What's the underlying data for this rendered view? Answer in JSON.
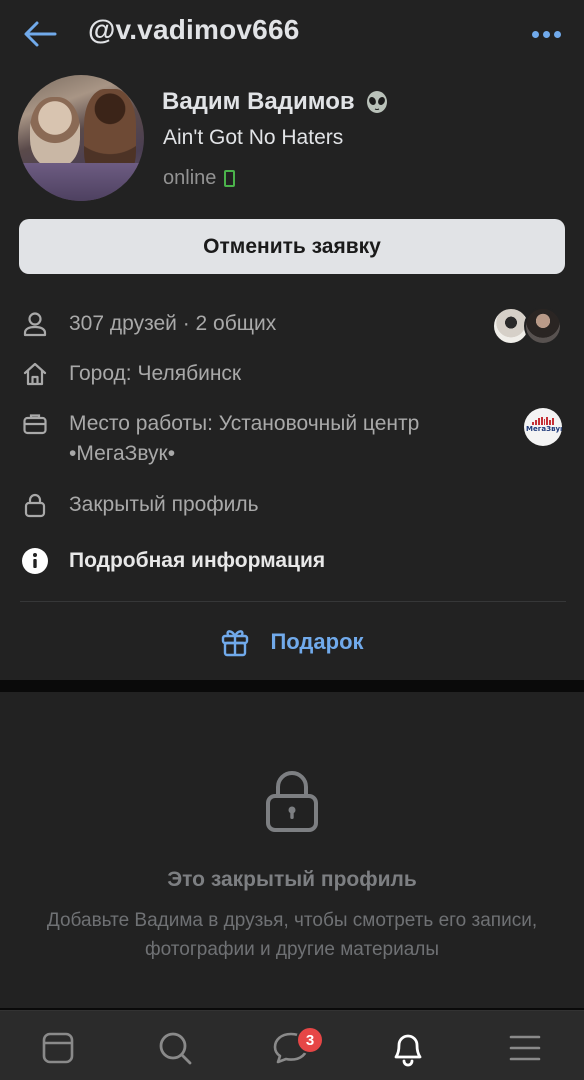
{
  "header": {
    "handle": "@v.vadimov666",
    "back_icon": "arrow-left-icon",
    "more_icon": "more-horizontal-icon"
  },
  "profile": {
    "name": "Вадим Вадимов",
    "name_emoji_icon": "alien-icon",
    "status": "Ain't Got No Haters",
    "online": "online",
    "online_device_icon": "mobile-phone-icon"
  },
  "actions": {
    "cancel_request_label": "Отменить заявку"
  },
  "info": {
    "friends": "307 друзей · 2 общих",
    "city": "Город: Челябинск",
    "work_line1": "Место работы: Установочный центр",
    "work_line2": "•МегаЗвук•",
    "work_logo_text": "МегаЗвук",
    "private": "Закрытый профиль",
    "details": "Подробная информация"
  },
  "gift": {
    "label": "Подарок"
  },
  "closed_profile": {
    "title": "Это закрытый профиль",
    "subtitle": "Добавьте Вадима в друзья, чтобы смотреть его записи, фотографии и другие материалы"
  },
  "tabbar": {
    "items": [
      {
        "icon": "feed-icon"
      },
      {
        "icon": "search-icon"
      },
      {
        "icon": "messages-icon",
        "badge": "3"
      },
      {
        "icon": "notifications-bell-icon"
      },
      {
        "icon": "menu-icon"
      }
    ]
  },
  "colors": {
    "accent": "#71aaeb",
    "background": "#222222",
    "online_green": "#4bb34b",
    "badge_red": "#e64646"
  }
}
